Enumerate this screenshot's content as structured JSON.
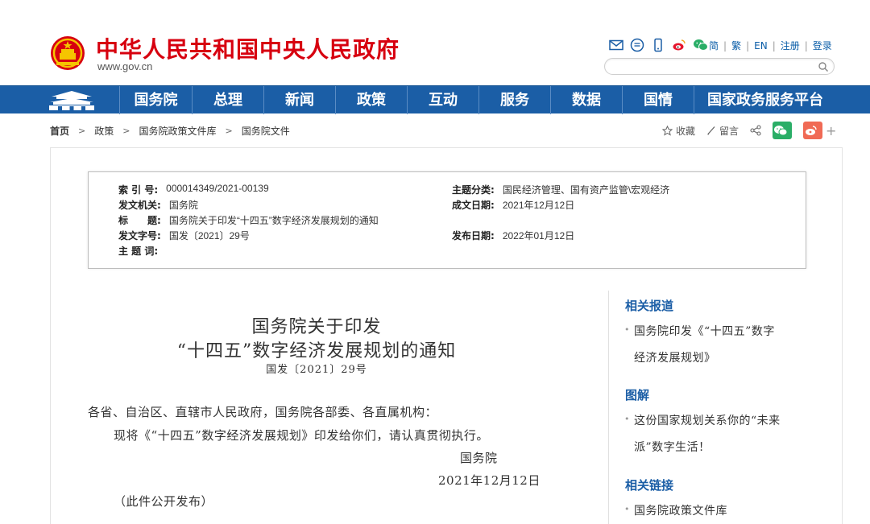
{
  "header": {
    "site_title": "中华人民共和国中央人民政府",
    "site_url": "www.gov.cn",
    "links": [
      "简",
      "繁",
      "EN",
      "注册",
      "登录"
    ],
    "search_placeholder": ""
  },
  "nav": {
    "items": [
      "国务院",
      "总理",
      "新闻",
      "政策",
      "互动",
      "服务",
      "数据",
      "国情",
      "国家政务服务平台"
    ]
  },
  "breadcrumb": [
    "首页",
    "政策",
    "国务院政策文件库",
    "国务院文件"
  ],
  "share": {
    "favorite": "收藏",
    "comment": "留言",
    "plus": "+"
  },
  "info": {
    "index_label": "索 引 号:",
    "index_value": "000014349/2021-00139",
    "topic_label": "主题分类:",
    "topic_value": "国民经济管理、国有资产监管\\宏观经济",
    "issuer_label": "发文机关:",
    "issuer_value": "国务院",
    "date_label": "成文日期:",
    "date_value": "2021年12月12日",
    "title_label": "标　　题:",
    "title_value": "国务院关于印发“十四五”数字经济发展规划的通知",
    "docno_label": "发文字号:",
    "docno_value": "国发〔2021〕29号",
    "publish_label": "发布日期:",
    "publish_value": "2022年01月12日",
    "keywords_label": "主 题 词:",
    "keywords_value": ""
  },
  "article": {
    "title_line1": "国务院关于印发",
    "title_line2": "“十四五”数字经济发展规划的通知",
    "doc_number": "国发〔2021〕29号",
    "addressee": "各省、自治区、直辖市人民政府，国务院各部委、各直属机构：",
    "body": "现将《“十四五”数字经济发展规划》印发给你们，请认真贯彻执行。",
    "signer": "国务院",
    "sign_date": "2021年12月12日",
    "note": "（此件公开发布）"
  },
  "sidebar": {
    "related_reports_head": "相关报道",
    "related_report_1a": "国务院印发《“十四五”数字",
    "related_report_1b": "经济发展规划》",
    "infographic_head": "图解",
    "infographic_1a": "这份国家规划关系你的“未来",
    "infographic_1b": "派”数字生活！",
    "related_links_head": "相关链接",
    "related_link_1": "国务院政策文件库"
  },
  "colors": {
    "brand_red": "#d7000f",
    "nav_blue": "#1b5ea6",
    "wechat_green": "#2aae67",
    "weibo_orange": "#f06a55"
  }
}
